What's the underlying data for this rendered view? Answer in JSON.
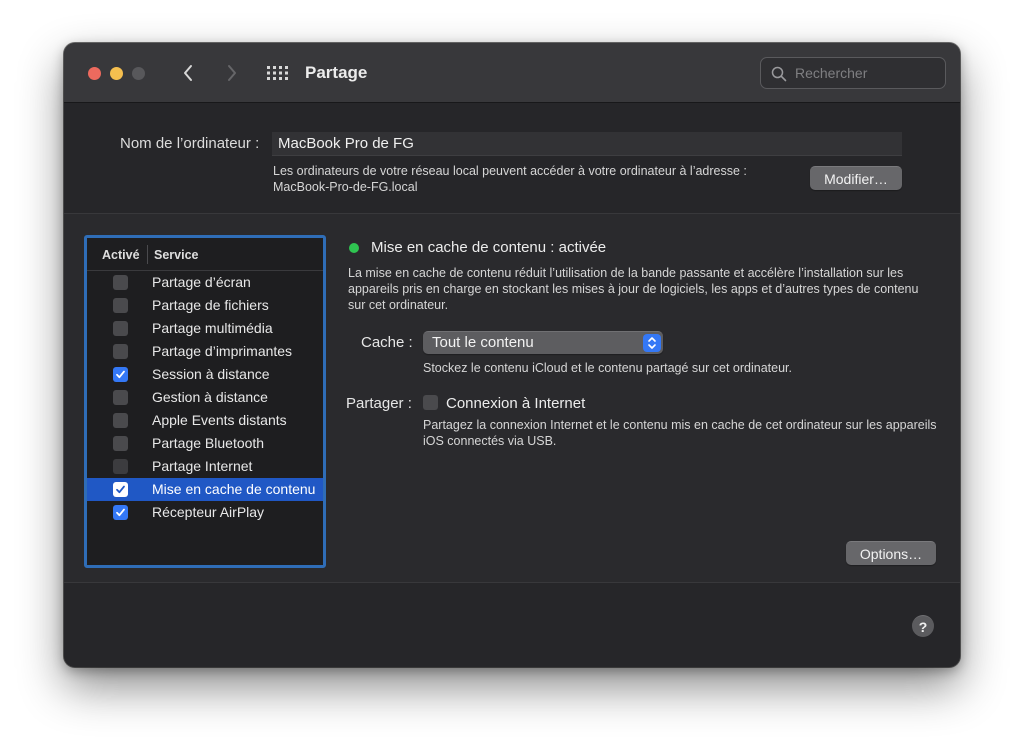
{
  "window": {
    "title": "Partage",
    "search": {
      "placeholder": "Rechercher",
      "value": ""
    }
  },
  "computer": {
    "label": "Nom de l’ordinateur :",
    "name": "MacBook Pro de FG",
    "address_text": "Les ordinateurs de votre réseau local peuvent accéder à votre ordinateur à l’adresse :",
    "address": "MacBook-Pro-de-FG.local",
    "modify_label": "Modifier…"
  },
  "services": {
    "col_active": "Activé",
    "col_service": "Service",
    "items": [
      {
        "label": "Partage d’écran",
        "enabled": false,
        "selected": false
      },
      {
        "label": "Partage de fichiers",
        "enabled": false,
        "selected": false
      },
      {
        "label": "Partage multimédia",
        "enabled": false,
        "selected": false
      },
      {
        "label": "Partage d’imprimantes",
        "enabled": false,
        "selected": false
      },
      {
        "label": "Session à distance",
        "enabled": true,
        "selected": false
      },
      {
        "label": "Gestion à distance",
        "enabled": false,
        "selected": false
      },
      {
        "label": "Apple Events distants",
        "enabled": false,
        "selected": false
      },
      {
        "label": "Partage Bluetooth",
        "enabled": false,
        "selected": false
      },
      {
        "label": "Partage Internet",
        "enabled": false,
        "selected": false
      },
      {
        "label": "Mise en cache de contenu",
        "enabled": true,
        "selected": true
      },
      {
        "label": "Récepteur AirPlay",
        "enabled": true,
        "selected": false
      }
    ]
  },
  "detail": {
    "status": "Mise en cache de contenu : activée",
    "status_color": "#2fc451",
    "description": "La mise en cache de contenu réduit l’utilisation de la bande passante et accélère l’installation sur les appareils pris en charge en stockant les mises à jour de logiciels, les apps et d’autres types de contenu sur cet ordinateur.",
    "cache_label": "Cache :",
    "cache_value": "Tout le contenu",
    "cache_note": "Stockez le contenu iCloud et le contenu partagé sur cet ordinateur.",
    "share_label": "Partager :",
    "share_checkbox_label": "Connexion à Internet",
    "share_checked": false,
    "share_note": "Partagez la connexion Internet et le contenu mis en cache de cet ordinateur sur les appareils iOS connectés via USB.",
    "options_label": "Options…"
  },
  "help_label": "?",
  "colors": {
    "accent": "#3478f6",
    "selection": "#2058c5",
    "list_focus_ring": "#2f6db7"
  }
}
